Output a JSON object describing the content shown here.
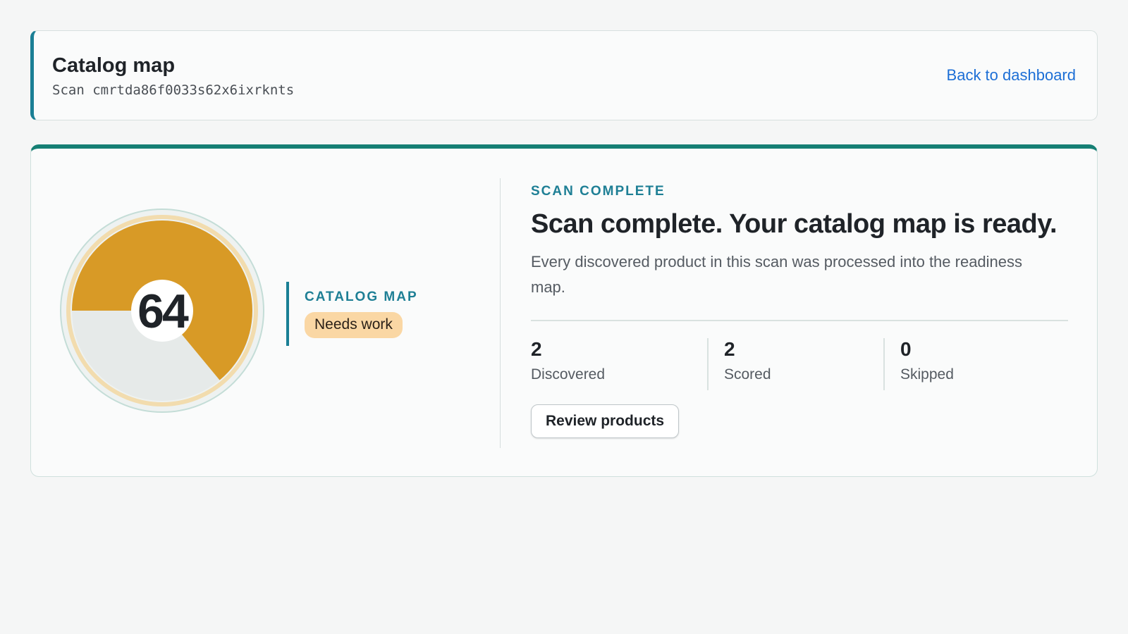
{
  "header": {
    "title": "Catalog map",
    "subtitle": "Scan cmrtda86f0033s62x6ixrknts",
    "back_link": "Back to dashboard"
  },
  "summary": {
    "score": "64",
    "score_fraction": 0.64,
    "eyebrow": "CATALOG MAP",
    "status_badge": "Needs work",
    "colors": {
      "accent": "#1a7f95",
      "score_fill": "#d89a26",
      "badge_bg": "#fad7a4"
    }
  },
  "result": {
    "eyebrow": "SCAN COMPLETE",
    "title": "Scan complete. Your catalog map is ready.",
    "description": "Every discovered product in this scan was processed into the readiness map.",
    "stats": [
      {
        "value": "2",
        "label": "Discovered"
      },
      {
        "value": "2",
        "label": "Scored"
      },
      {
        "value": "0",
        "label": "Skipped"
      }
    ],
    "review_button": "Review products"
  }
}
